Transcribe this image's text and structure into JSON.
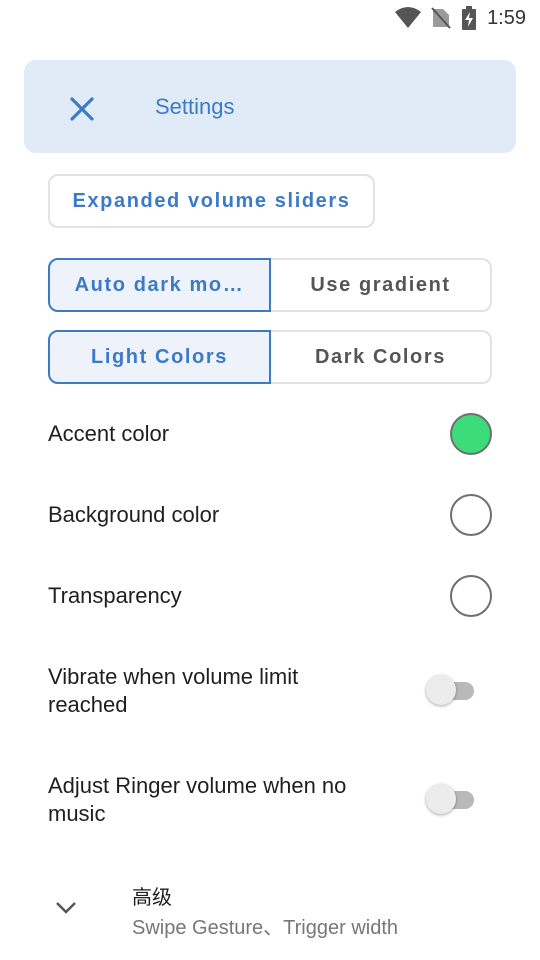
{
  "status_bar": {
    "time": "1:59"
  },
  "header": {
    "title": "Settings"
  },
  "buttons": {
    "expanded_sliders": "Expanded volume sliders",
    "auto_dark_mode": "Auto dark mo…",
    "use_gradient": "Use gradient",
    "light_colors": "Light Colors",
    "dark_colors": "Dark Colors"
  },
  "rows": {
    "accent_color": {
      "label": "Accent color",
      "color": "#3ddc7a"
    },
    "background_color": {
      "label": "Background color",
      "color": "#ffffff"
    },
    "transparency": {
      "label": "Transparency",
      "color": "#ffffff"
    }
  },
  "toggles": {
    "vibrate": {
      "label": "Vibrate when volume limit reached",
      "on": false
    },
    "adjust_ringer": {
      "label": "Adjust Ringer volume when no music",
      "on": false
    }
  },
  "advanced": {
    "title": "高级",
    "subtitle": "Swipe Gesture、Trigger width"
  },
  "colors": {
    "accent": "#3d7ac6",
    "header_bg": "#e1ebf8"
  }
}
